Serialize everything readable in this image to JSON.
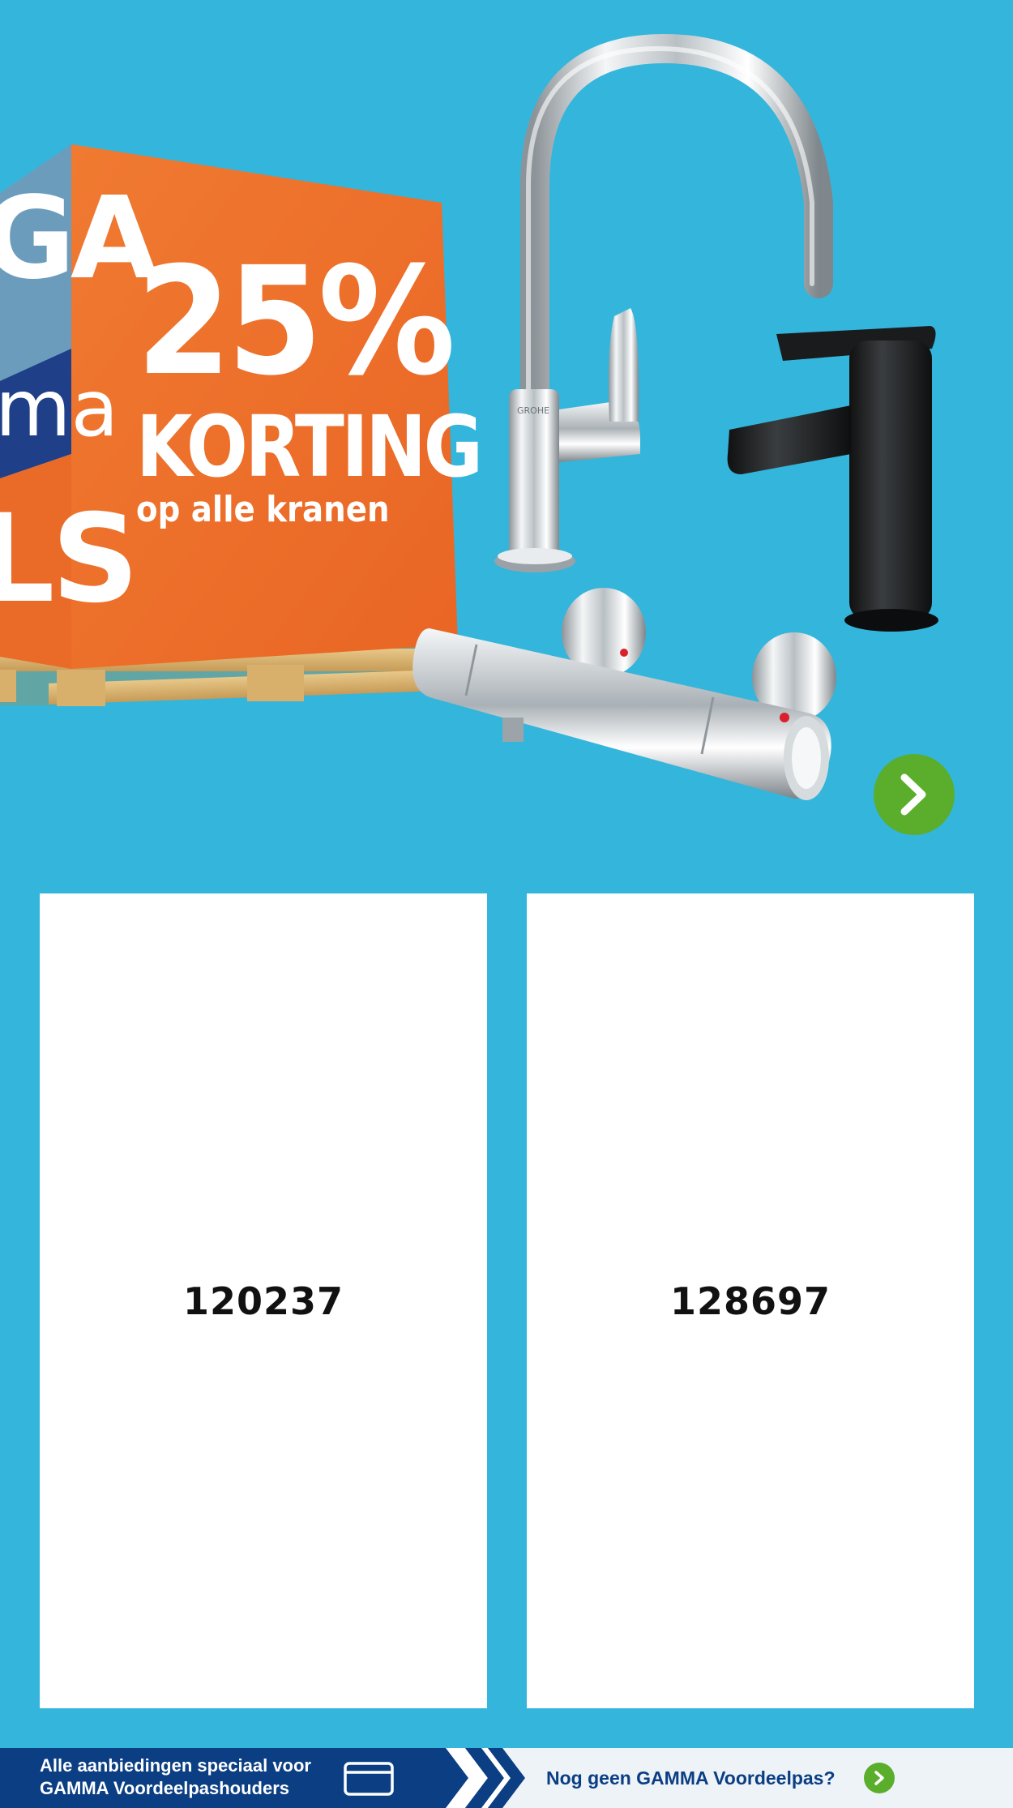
{
  "hero": {
    "side_text_top": "GA",
    "side_text_mid": "ma",
    "side_text_bottom": "LS",
    "discount_percentage": "25%",
    "discount_word": "KORTING",
    "discount_subtitle": "op alle kranen",
    "faucet_brand": "GROHE",
    "next_icon": "chevron-right-icon"
  },
  "products": [
    {
      "code": "120237"
    },
    {
      "code": "128697"
    }
  ],
  "banner": {
    "left_line1": "Alle aanbiedingen speciaal voor",
    "left_line2": "GAMMA Voordeelpashouders",
    "card_icon": "card-icon",
    "right_link": "Nog geen GAMMA Voordeelpas?",
    "right_icon": "chevron-right-icon"
  },
  "colors": {
    "background": "#34b5db",
    "box_orange": "#ec6f2a",
    "box_blue": "#1d3f8a",
    "accent_green": "#5aae2c",
    "banner_navy": "#0b3e83",
    "banner_light": "#eef3f8"
  }
}
